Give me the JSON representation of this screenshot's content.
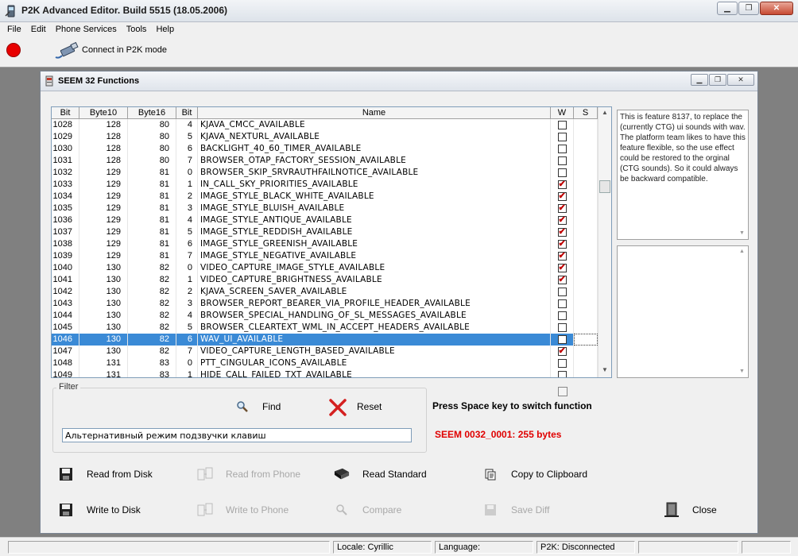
{
  "window": {
    "title": "P2K Advanced Editor. Build 5515 (18.05.2006)"
  },
  "menu": [
    "File",
    "Edit",
    "Phone Services",
    "Tools",
    "Help"
  ],
  "toolbar": {
    "connect_label": "Connect in P2K mode",
    "status_color": "#e80000"
  },
  "child": {
    "title": "SEEM 32 Functions"
  },
  "grid": {
    "columns": [
      "Bit",
      "Byte10",
      "Byte16",
      "Bit",
      "Name",
      "W",
      "S"
    ],
    "selected_bit": "1046",
    "rows": [
      {
        "bit": "1028",
        "b10": "128",
        "b16": "80",
        "bt": "4",
        "name": "KJAVA_CMCC_AVAILABLE",
        "w": false
      },
      {
        "bit": "1029",
        "b10": "128",
        "b16": "80",
        "bt": "5",
        "name": "KJAVA_NEXTURL_AVAILABLE",
        "w": false
      },
      {
        "bit": "1030",
        "b10": "128",
        "b16": "80",
        "bt": "6",
        "name": "BACKLIGHT_40_60_TIMER_AVAILABLE",
        "w": false
      },
      {
        "bit": "1031",
        "b10": "128",
        "b16": "80",
        "bt": "7",
        "name": "BROWSER_OTAP_FACTORY_SESSION_AVAILABLE",
        "w": false
      },
      {
        "bit": "1032",
        "b10": "129",
        "b16": "81",
        "bt": "0",
        "name": "BROWSER_SKIP_SRVRAUTHFAILNOTICE_AVAILABLE",
        "w": false
      },
      {
        "bit": "1033",
        "b10": "129",
        "b16": "81",
        "bt": "1",
        "name": "IN_CALL_SKY_PRIORITIES_AVAILABLE",
        "w": true
      },
      {
        "bit": "1034",
        "b10": "129",
        "b16": "81",
        "bt": "2",
        "name": "IMAGE_STYLE_BLACK_WHITE_AVAILABLE",
        "w": true
      },
      {
        "bit": "1035",
        "b10": "129",
        "b16": "81",
        "bt": "3",
        "name": "IMAGE_STYLE_BLUISH_AVAILABLE",
        "w": true
      },
      {
        "bit": "1036",
        "b10": "129",
        "b16": "81",
        "bt": "4",
        "name": "IMAGE_STYLE_ANTIQUE_AVAILABLE",
        "w": true
      },
      {
        "bit": "1037",
        "b10": "129",
        "b16": "81",
        "bt": "5",
        "name": "IMAGE_STYLE_REDDISH_AVAILABLE",
        "w": true
      },
      {
        "bit": "1038",
        "b10": "129",
        "b16": "81",
        "bt": "6",
        "name": "IMAGE_STYLE_GREENISH_AVAILABLE",
        "w": true
      },
      {
        "bit": "1039",
        "b10": "129",
        "b16": "81",
        "bt": "7",
        "name": "IMAGE_STYLE_NEGATIVE_AVAILABLE",
        "w": true
      },
      {
        "bit": "1040",
        "b10": "130",
        "b16": "82",
        "bt": "0",
        "name": "VIDEO_CAPTURE_IMAGE_STYLE_AVAILABLE",
        "w": true
      },
      {
        "bit": "1041",
        "b10": "130",
        "b16": "82",
        "bt": "1",
        "name": "VIDEO_CAPTURE_BRIGHTNESS_AVAILABLE",
        "w": true
      },
      {
        "bit": "1042",
        "b10": "130",
        "b16": "82",
        "bt": "2",
        "name": "KJAVA_SCREEN_SAVER_AVAILABLE",
        "w": false
      },
      {
        "bit": "1043",
        "b10": "130",
        "b16": "82",
        "bt": "3",
        "name": "BROWSER_REPORT_BEARER_VIA_PROFILE_HEADER_AVAILABLE",
        "w": false
      },
      {
        "bit": "1044",
        "b10": "130",
        "b16": "82",
        "bt": "4",
        "name": "BROWSER_SPECIAL_HANDLING_OF_SL_MESSAGES_AVAILABLE",
        "w": false
      },
      {
        "bit": "1045",
        "b10": "130",
        "b16": "82",
        "bt": "5",
        "name": "BROWSER_CLEARTEXT_WML_IN_ACCEPT_HEADERS_AVAILABLE",
        "w": false
      },
      {
        "bit": "1046",
        "b10": "130",
        "b16": "82",
        "bt": "6",
        "name": "WAV_UI_AVAILABLE",
        "w": false
      },
      {
        "bit": "1047",
        "b10": "130",
        "b16": "82",
        "bt": "7",
        "name": "VIDEO_CAPTURE_LENGTH_BASED_AVAILABLE",
        "w": true
      },
      {
        "bit": "1048",
        "b10": "131",
        "b16": "83",
        "bt": "0",
        "name": "PTT_CINGULAR_ICONS_AVAILABLE",
        "w": false
      },
      {
        "bit": "1049",
        "b10": "131",
        "b16": "83",
        "bt": "1",
        "name": "HIDE_CALL_FAILED_TXT_AVAILABLE",
        "w": false
      }
    ]
  },
  "description": "This is feature 8137, to replace the (currently CTG) ui sounds with wav. The platform team likes to have this feature flexible, so the use effect could be restored to the orginal (CTG sounds). So it could always be backward compatible.",
  "filter": {
    "legend": "Filter",
    "find_label": "Find",
    "reset_label": "Reset",
    "value": "Альтернативный режим подзвучки клавиш"
  },
  "switch_hint": "Press Space key to switch function",
  "seem_info": "SEEM 0032_0001: 255 bytes",
  "actions": {
    "read_disk": "Read from Disk",
    "read_phone": "Read from Phone",
    "read_standard": "Read Standard",
    "copy_clipboard": "Copy to Clipboard",
    "write_disk": "Write to Disk",
    "write_phone": "Write to Phone",
    "compare": "Compare",
    "save_diff": "Save Diff",
    "close": "Close"
  },
  "statusbar": {
    "locale": "Locale: Cyrillic",
    "language": "Language:",
    "p2k": "P2K: Disconnected"
  }
}
